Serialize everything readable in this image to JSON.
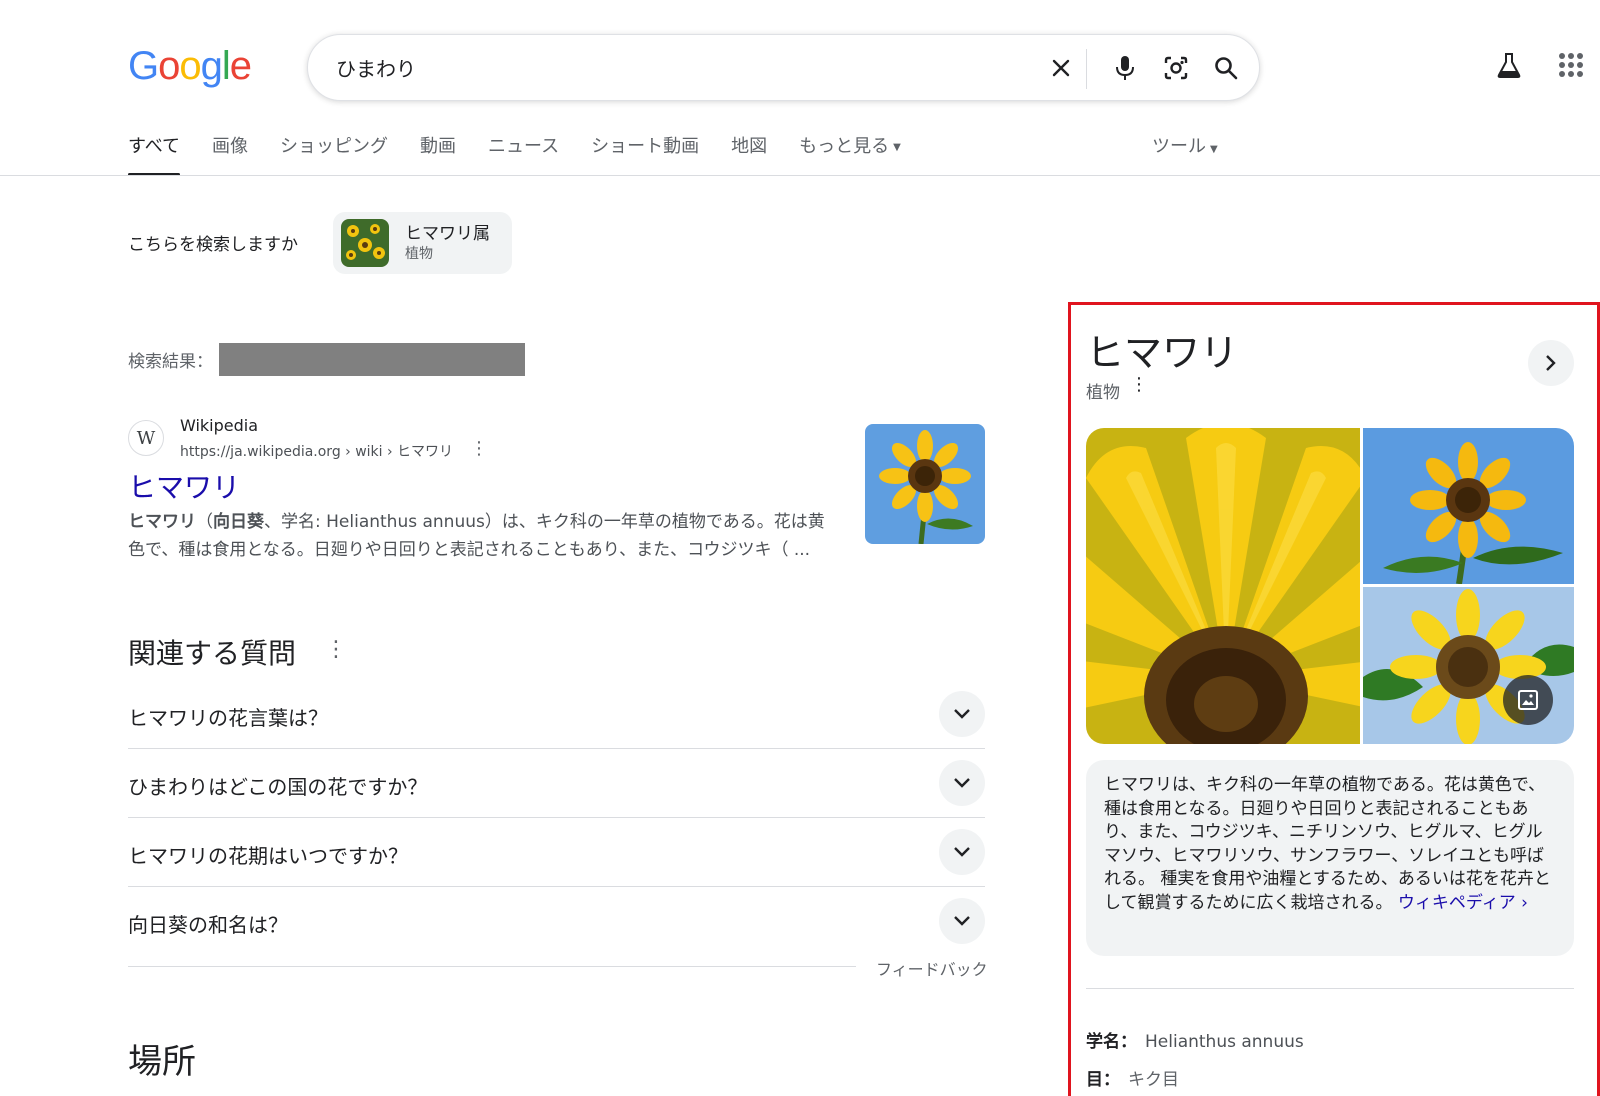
{
  "logo": {
    "letters": [
      "G",
      "o",
      "o",
      "g",
      "l",
      "e"
    ],
    "colors": [
      "#4285f4",
      "#ea4335",
      "#fbbc05",
      "#4285f4",
      "#34a853",
      "#ea4335"
    ]
  },
  "search": {
    "query": "ひまわり",
    "icons": [
      "close-icon",
      "mic-icon",
      "lens-icon",
      "search-icon"
    ]
  },
  "top_right": {
    "labs_icon": "flask-icon",
    "apps_icon": "apps-grid-icon"
  },
  "tabs": [
    {
      "label": "すべて",
      "active": true
    },
    {
      "label": "画像"
    },
    {
      "label": "ショッピング"
    },
    {
      "label": "動画"
    },
    {
      "label": "ニュース"
    },
    {
      "label": "ショート動画"
    },
    {
      "label": "地図"
    },
    {
      "label": "もっと見る",
      "caret": true
    }
  ],
  "tools_label": "ツール",
  "did_you_mean": {
    "label": "こちらを検索しますか",
    "chip_title": "ヒマワリ属",
    "chip_sub": "植物"
  },
  "results_label": "検索結果：",
  "result": {
    "favicon": "W",
    "site": "Wikipedia",
    "url": "https://ja.wikipedia.org › wiki › ヒマワリ",
    "title": "ヒマワリ",
    "snippet_bold1": "ヒマワリ",
    "snippet_paren_open": "（",
    "snippet_bold2": "向日葵",
    "snippet_rest": "、学名: Helianthus annuus）は、キク科の一年草の植物である。花は黄色で、種は食用となる。日廻りや日回りと表記されることもあり、また、コウジツキ（ ..."
  },
  "related": {
    "title": "関連する質問",
    "questions": [
      "ヒマワリの花言葉は？",
      "ひまわりはどこの国の花ですか？",
      "ヒマワリの花期はいつですか？",
      "向日葵の和名は？"
    ],
    "feedback": "フィードバック"
  },
  "places_title": "場所",
  "knowledge_panel": {
    "title": "ヒマワリ",
    "subtitle": "植物",
    "description": "ヒマワリは、キク科の一年草の植物である。花は黄色で、種は食用となる。日廻りや日回りと表記されることもあり、また、コウジツキ、ニチリンソウ、ヒグルマ、ヒグルマソウ、ヒマワリソウ、サンフラワー、ソレイユとも呼ばれる。 種実を食用や油糧とするため、あるいは花を花卉として観賞するために広く栽培される。",
    "source_link": "ウィキペディア ›",
    "facts": [
      {
        "key": "学名：",
        "value": "Helianthus annuus"
      },
      {
        "key": "目：",
        "value": "キク目"
      }
    ]
  },
  "colors": {
    "link_blue": "#1a0dab",
    "highlight_red": "#e0141e",
    "chip_bg": "#f1f3f4"
  }
}
